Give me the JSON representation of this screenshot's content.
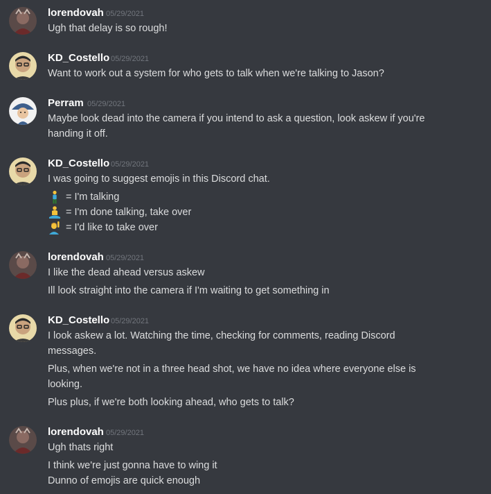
{
  "messages": [
    {
      "author": "lorendovah",
      "timestamp": "05/29/2021",
      "avatar": "lorendovah-avatar",
      "lines": [
        "Ugh that delay is so rough!"
      ]
    },
    {
      "author": "KD_Costello",
      "timestamp": "05/29/2021",
      "avatar": "kd-costello-avatar",
      "lines": [
        "Want to work out a system for who gets to talk when we're talking to Jason?"
      ]
    },
    {
      "author": "Perram",
      "timestamp": "05/29/2021",
      "avatar": "perram-avatar",
      "lines": [
        "Maybe look dead into the camera if you intend to ask a question, look askew if you're",
        "handing it off."
      ]
    },
    {
      "author": "KD_Costello",
      "timestamp": "05/29/2021",
      "avatar": "kd-costello-avatar",
      "lines": [
        "I was going to suggest emojis in this Discord chat."
      ],
      "emoji_lines": [
        {
          "emoji": "person-standing-emoji",
          "text": "= I'm talking"
        },
        {
          "emoji": "person-in-lotus-position-emoji",
          "text": "= I'm done talking, take over"
        },
        {
          "emoji": "person-raising-hand-emoji",
          "text": "= I'd like to take over"
        }
      ]
    },
    {
      "author": "lorendovah",
      "timestamp": "05/29/2021",
      "avatar": "lorendovah-avatar",
      "lines": [
        "I like the dead ahead versus askew",
        "Ill look straight into the camera if I'm waiting to get something in"
      ]
    },
    {
      "author": "KD_Costello",
      "timestamp": "05/29/2021",
      "avatar": "kd-costello-avatar",
      "lines": [
        "I look askew a lot. Watching the time, checking for comments, reading Discord",
        "messages.",
        "Plus, when we're not in a three head shot, we have no idea where everyone else is",
        "looking.",
        "Plus plus, if we're both looking ahead, who gets to talk?"
      ]
    },
    {
      "author": "lorendovah",
      "timestamp": "05/29/2021",
      "avatar": "lorendovah-avatar",
      "lines": [
        "Ugh thats right",
        "I think we're just gonna have to wing it",
        "Dunno of emojis are quick enough"
      ]
    }
  ],
  "colors": {
    "background": "#36393f",
    "username": "#ffffff",
    "timestamp": "#72767d",
    "text": "#dcddde"
  }
}
